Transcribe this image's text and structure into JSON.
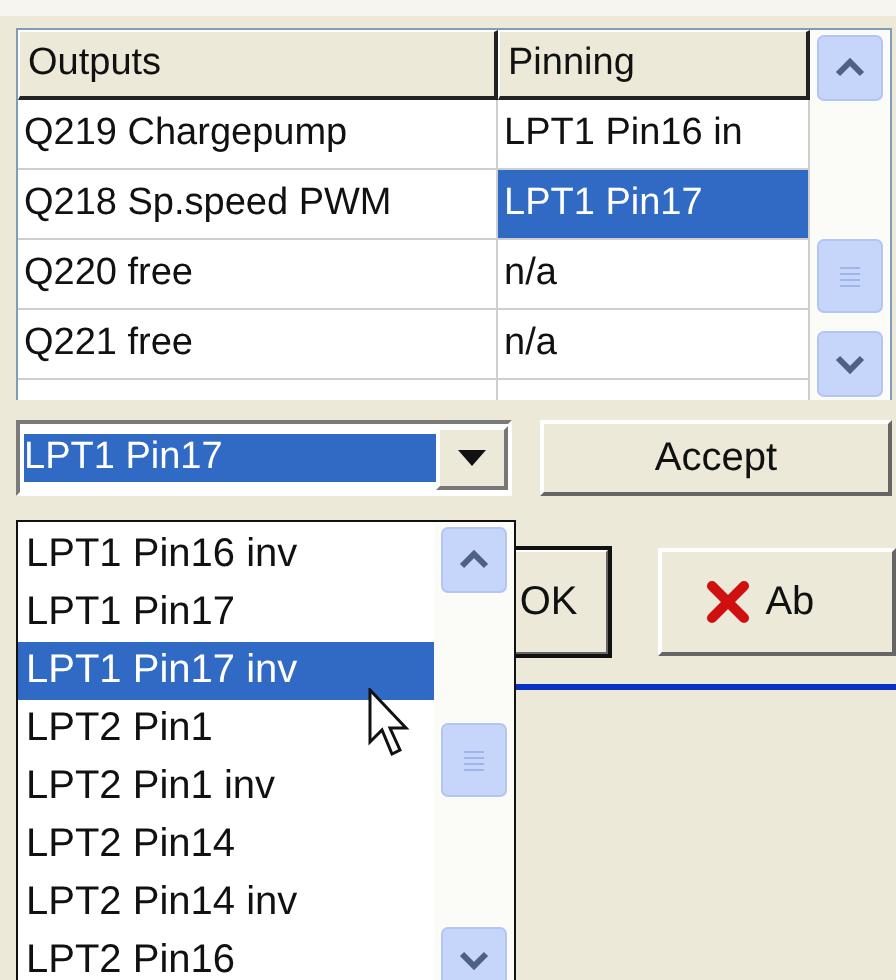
{
  "table": {
    "columns": [
      "Outputs",
      "Pinning"
    ],
    "rows": [
      {
        "output": "Q219 Chargepump",
        "pinning": "LPT1 Pin16 in",
        "selected": false
      },
      {
        "output": "Q218 Sp.speed PWM",
        "pinning": "LPT1 Pin17",
        "selected": true
      },
      {
        "output": "Q220 free",
        "pinning": "n/a",
        "selected": false
      },
      {
        "output": "Q221 free",
        "pinning": "n/a",
        "selected": false
      }
    ]
  },
  "combo": {
    "value": "LPT1 Pin17"
  },
  "accept_button": "Accept",
  "dropdown": {
    "items": [
      {
        "label": "LPT1 Pin16 inv",
        "selected": false
      },
      {
        "label": "LPT1 Pin17",
        "selected": false
      },
      {
        "label": "LPT1 Pin17 inv",
        "selected": true
      },
      {
        "label": "LPT2 Pin1",
        "selected": false
      },
      {
        "label": "LPT2 Pin1 inv",
        "selected": false
      },
      {
        "label": "LPT2 Pin14",
        "selected": false
      },
      {
        "label": "LPT2 Pin14 inv",
        "selected": false
      },
      {
        "label": "LPT2 Pin16",
        "selected": false
      }
    ]
  },
  "buttons": [
    {
      "kind": "ok",
      "label": "OK"
    },
    {
      "kind": "abort",
      "label": "Ab"
    }
  ]
}
